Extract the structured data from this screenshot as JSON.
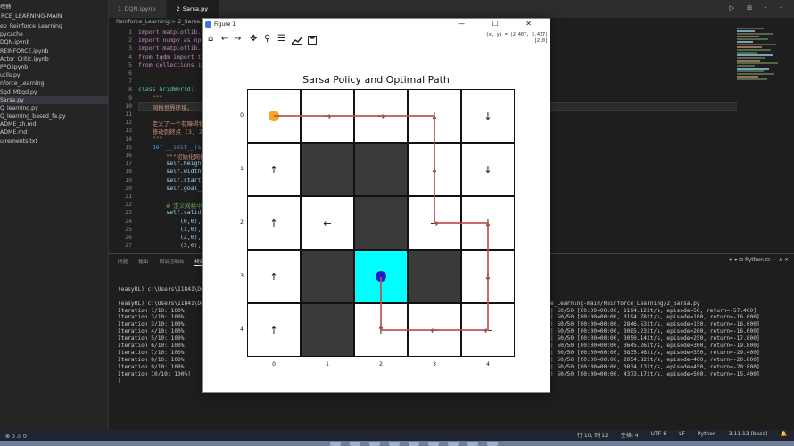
{
  "sidebar": {
    "header": "RCE_LEARNING-MAIN",
    "items": [
      "ep_Reinforce_Learning",
      "pycache__",
      "DQN.ipynb",
      "REINFORCE.ipynb",
      "Actor_Critic.ipynb",
      "PPO.ipynb",
      "utils.py",
      "nforce_Learning",
      "Sgd_Mbgd.py",
      "Sarsa.py",
      "Q_learning.py",
      "Q_learning_based_fa.py",
      "ADME_zh.md",
      "ADME.md",
      "uirements.txt"
    ],
    "selected_index": 9,
    "top_label": "理器"
  },
  "tabs": [
    {
      "label": "1_DQN.ipynb",
      "active": false
    },
    {
      "label": "2_Sarsa.py",
      "active": true
    }
  ],
  "window_controls": "▷ ⊟ ···",
  "breadcrumb": "Reinforce_Learning  >  2_Sarsa.py  >  ...",
  "editor": {
    "lines": [
      {
        "no": "1",
        "text": "import matplotlib.pyplot as plt"
      },
      {
        "no": "2",
        "text": "import numpy as np"
      },
      {
        "no": "3",
        "text": "import matplotlib.patches as patches"
      },
      {
        "no": "4",
        "text": "from tqdm import tqdm"
      },
      {
        "no": "5",
        "text": "from collections import defaultdict"
      },
      {
        "no": "6",
        "text": ""
      },
      {
        "no": "7",
        "text": ""
      },
      {
        "no": "8",
        "text": "class GridWorld:"
      },
      {
        "no": "9",
        "text": "    \"\"\""
      },
      {
        "no": "10",
        "text": "    网格世界环境。"
      },
      {
        "no": "11",
        "text": ""
      },
      {
        "no": "12",
        "text": "    定义了一个有障碍物的网格世界"
      },
      {
        "no": "13",
        "text": "    移动到终点 (3, 2)"
      },
      {
        "no": "14",
        "text": "    \"\"\""
      },
      {
        "no": "15",
        "text": "    def __init__(self):"
      },
      {
        "no": "16",
        "text": "        \"\"\"初始化网格世界"
      },
      {
        "no": "17",
        "text": "        self.height"
      },
      {
        "no": "18",
        "text": "        self.width"
      },
      {
        "no": "19",
        "text": "        self.start_"
      },
      {
        "no": "20",
        "text": "        self.goal_s"
      },
      {
        "no": "21",
        "text": ""
      },
      {
        "no": "22",
        "text": "        # 定义网格中"
      },
      {
        "no": "23",
        "text": "        self.valid_"
      },
      {
        "no": "24",
        "text": "            (0,0),"
      },
      {
        "no": "25",
        "text": "            (1,0),"
      },
      {
        "no": "26",
        "text": "            (2,0),"
      },
      {
        "no": "27",
        "text": "            (3,0),"
      }
    ]
  },
  "panel": {
    "tabs": [
      "问题",
      "输出",
      "调试控制台",
      "终端",
      "端口"
    ],
    "active_tab": 3,
    "right_controls": "+  ▾   ⊡ Python   ⊟  ⋯  ∧  ✕"
  },
  "terminal": {
    "lines": [
      "",
      "(easyRL) c:\\Users\\11841\\Desk",
      "",
      "(easyRL) c:\\Users\\11841\\Desk",
      "Iteration 1/10: 100%|",
      "Iteration 2/10: 100%|",
      "Iteration 3/10: 100%|",
      "Iteration 4/10: 100%|",
      "Iteration 5/10: 100%|",
      "Iteration 6/10: 100%|",
      "Iteration 7/10: 100%|",
      "Iteration 8/10: 100%|",
      "Iteration 9/10: 100%|",
      "Iteration 10/10: 100%|",
      "▯"
    ],
    "right_lines": [
      "",
      "",
      "",
      "e_Learning-main/Reinforce_Learning/2_Sarsa.py",
      "| 50/50 [00:00<00:00, 1194.12it/s, episode=50, return=-57.400]",
      "| 50/50 [00:00<00:00, 3194.78it/s, episode=100, return=-16.000]",
      "| 50/50 [00:00<00:00, 2846.53it/s, episode=150, return=-16.000]",
      "| 50/50 [00:00<00:00, 3085.23it/s, episode=200, return=-16.000]",
      "| 50/50 [00:00<00:00, 3050.14it/s, episode=250, return=-17.800]",
      "| 50/50 [00:00<00:00, 3645.26it/s, episode=300, return=-19.800]",
      "| 50/50 [00:00<00:00, 3835.46it/s, episode=350, return=-29.400]",
      "| 50/50 [00:00<00:00, 2054.82it/s, episode=400, return=-20.800]",
      "| 50/50 [00:00<00:00, 3834.13it/s, episode=450, return=-20.800]",
      "| 50/50 [00:00<00:00, 4373.17it/s, episode=500, return=-15.400]",
      ""
    ]
  },
  "statusbar": {
    "left": "⊗ 0 ⚠ 0",
    "position": "行 10, 列 12",
    "spaces": "空格: 4",
    "encoding": "UTF-8",
    "eol": "LF",
    "language": "Python",
    "interpreter": "3.11.13 (base)",
    "bell": "🔔"
  },
  "figure": {
    "window_title": "Figure 1",
    "window_controls": "— ☐ ✕",
    "coords_line1": "(x, y) = (2.407, 3.437)",
    "coords_line2": "[2.0]",
    "toolbar_icons": [
      "home-icon",
      "back-icon",
      "forward-icon",
      "pan-icon",
      "zoom-icon",
      "configure-icon",
      "axes-icon",
      "save-icon"
    ],
    "plot_title": "Sarsa Policy and Optimal Path",
    "xticks": [
      "0",
      "1",
      "2",
      "3",
      "4"
    ],
    "yticks": [
      "0",
      "1",
      "2",
      "3",
      "4"
    ],
    "policy": [
      [
        "→",
        "→",
        "→",
        "↓",
        "↓"
      ],
      [
        "↑",
        "",
        "",
        "↓",
        "↓"
      ],
      [
        "↑",
        "←",
        "",
        "→",
        "↓"
      ],
      [
        "↑",
        "",
        "",
        "",
        "↓"
      ],
      [
        "↑",
        "",
        "↑",
        "←",
        "←"
      ]
    ],
    "walls": [
      [
        1,
        1
      ],
      [
        1,
        2
      ],
      [
        2,
        2
      ],
      [
        3,
        1
      ],
      [
        3,
        3
      ],
      [
        4,
        1
      ]
    ],
    "goal": [
      3,
      2
    ],
    "start": [
      0,
      0
    ],
    "path": [
      [
        0,
        0
      ],
      [
        0,
        1
      ],
      [
        0,
        2
      ],
      [
        0,
        3
      ],
      [
        1,
        3
      ],
      [
        2,
        3
      ],
      [
        2,
        4
      ],
      [
        3,
        4
      ],
      [
        4,
        4
      ],
      [
        4,
        3
      ],
      [
        4,
        2
      ],
      [
        3,
        2
      ]
    ],
    "colors": {
      "wall": "#3a3a3a",
      "goal": "#00ffff",
      "path": "#c0504d",
      "start": "#f5a623",
      "agent": "#1a1ad0"
    }
  }
}
